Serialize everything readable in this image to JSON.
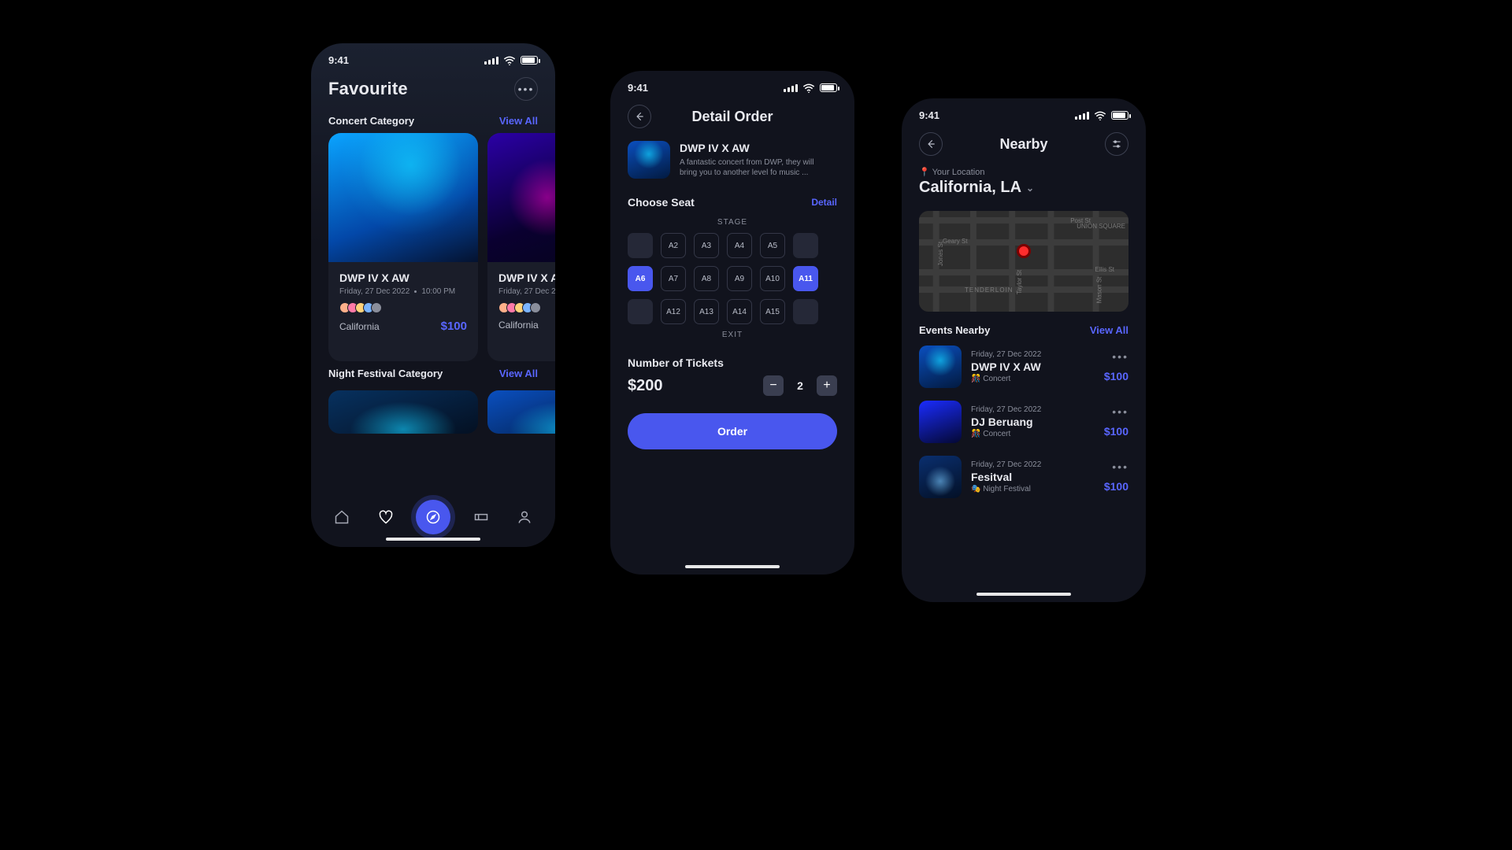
{
  "status": {
    "time": "9:41"
  },
  "favourite": {
    "title": "Favourite",
    "section1": {
      "title": "Concert Category",
      "view_all": "View All"
    },
    "section2": {
      "title": "Night Festival Category",
      "view_all": "View All"
    },
    "card": {
      "title": "DWP IV X AW",
      "date": "Friday, 27 Dec 2022",
      "time": "10:00 PM",
      "location": "California",
      "price": "$100"
    },
    "card2": {
      "title": "DWP IV X A",
      "location": "California"
    }
  },
  "detail": {
    "title": "Detail Order",
    "event": {
      "title": "DWP IV X AW",
      "desc": "A fantastic concert from DWP, they will bring you to another level fo music ..."
    },
    "choose": {
      "label": "Choose Seat",
      "detail": "Detail"
    },
    "stage": "STAGE",
    "exit": "EXIT",
    "seats": {
      "r1": [
        "",
        "A2",
        "A3",
        "A4",
        "A5",
        ""
      ],
      "r2": [
        "A6",
        "A7",
        "A8",
        "A9",
        "A10",
        "A11"
      ],
      "r3": [
        "",
        "A12",
        "A13",
        "A14",
        "A15",
        ""
      ]
    },
    "selected": [
      "A6",
      "A11"
    ],
    "tickets_label": "Number of Tickets",
    "total": "$200",
    "qty": "2",
    "order": "Order"
  },
  "nearby": {
    "title": "Nearby",
    "your_location_label": "Your Location",
    "location": "California, LA",
    "events_label": "Events Nearby",
    "view_all": "View All",
    "events": [
      {
        "date": "Friday, 27 Dec 2022",
        "title": "DWP IV X AW",
        "cat": "🎊 Concert",
        "price": "$100"
      },
      {
        "date": "Friday, 27 Dec 2022",
        "title": "DJ Beruang",
        "cat": "🎊 Concert",
        "price": "$100"
      },
      {
        "date": "Friday, 27 Dec 2022",
        "title": "Fesitval",
        "cat": "🎭 Night Festival",
        "price": "$100"
      }
    ],
    "map": {
      "streets": [
        "Post St",
        "Geary St",
        "Ellis St",
        "Jones St",
        "Taylor St",
        "Mason St"
      ],
      "district": "TENDERLOIN",
      "corner": "UNION SQUARE"
    }
  }
}
